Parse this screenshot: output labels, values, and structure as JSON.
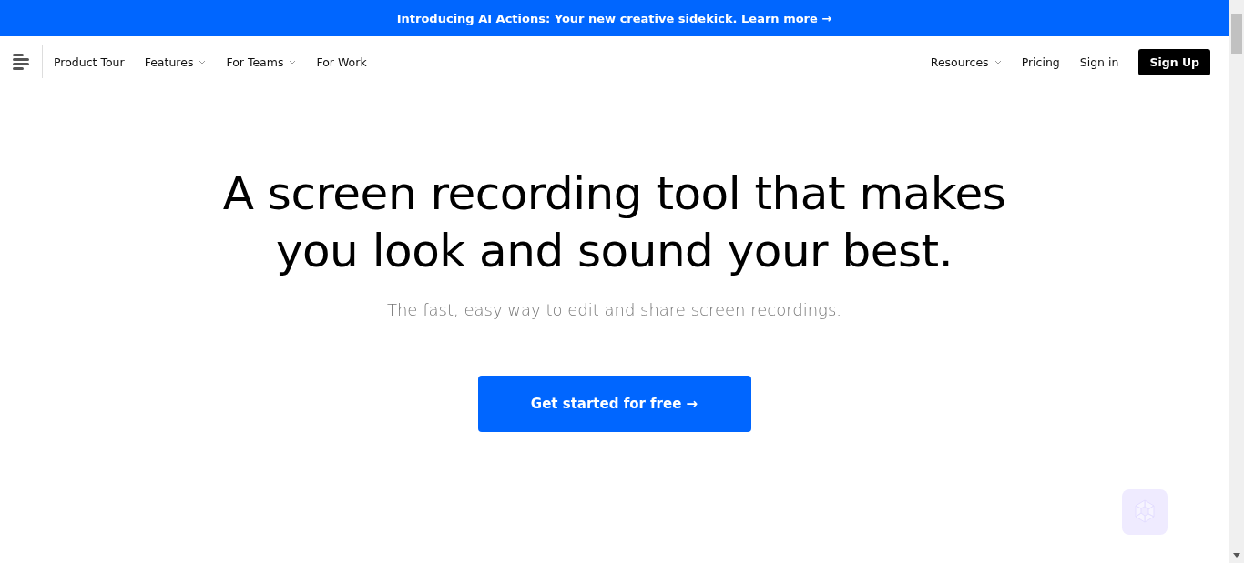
{
  "banner": {
    "text": "Introducing AI Actions: Your new creative sidekick. Learn more →"
  },
  "nav": {
    "left": [
      {
        "label": "Product Tour",
        "dropdown": false
      },
      {
        "label": "Features",
        "dropdown": true
      },
      {
        "label": "For Teams",
        "dropdown": true
      },
      {
        "label": "For Work",
        "dropdown": false
      }
    ],
    "right": [
      {
        "label": "Resources",
        "dropdown": true
      },
      {
        "label": "Pricing",
        "dropdown": false
      },
      {
        "label": "Sign in",
        "dropdown": false
      }
    ],
    "cta": "Sign Up"
  },
  "hero": {
    "title": "A screen recording tool that makes you look and sound your best.",
    "subtitle": "The fast, easy way to edit and share screen recordings.",
    "button": "Get started for free →"
  }
}
